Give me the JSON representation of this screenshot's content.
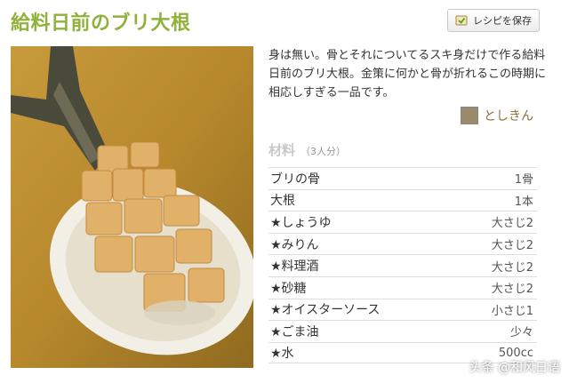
{
  "recipe": {
    "title": "給料日前のブリ大根",
    "save_label": "レシピを保存",
    "description": "身は無い。骨とそれについてるスキ身だけで作る給料日前のブリ大根。金策に何かと骨が折れるこの時期に相応しすぎる一品です。",
    "author": "としきん",
    "ingredients_title": "材料",
    "servings": "（3人分）",
    "ingredients": [
      {
        "name": "ブリの骨",
        "amount": "1骨"
      },
      {
        "name": "大根",
        "amount": "1本"
      },
      {
        "name": "★しょうゆ",
        "amount": "大さじ2"
      },
      {
        "name": "★みりん",
        "amount": "大さじ2"
      },
      {
        "name": "★料理酒",
        "amount": "大さじ2"
      },
      {
        "name": "★砂糖",
        "amount": "大さじ2"
      },
      {
        "name": "★オイスターソース",
        "amount": "小さじ1"
      },
      {
        "name": "★ごま油",
        "amount": "少々"
      },
      {
        "name": "★水",
        "amount": "500cc"
      }
    ]
  },
  "watermark": "头条 @和风日语"
}
